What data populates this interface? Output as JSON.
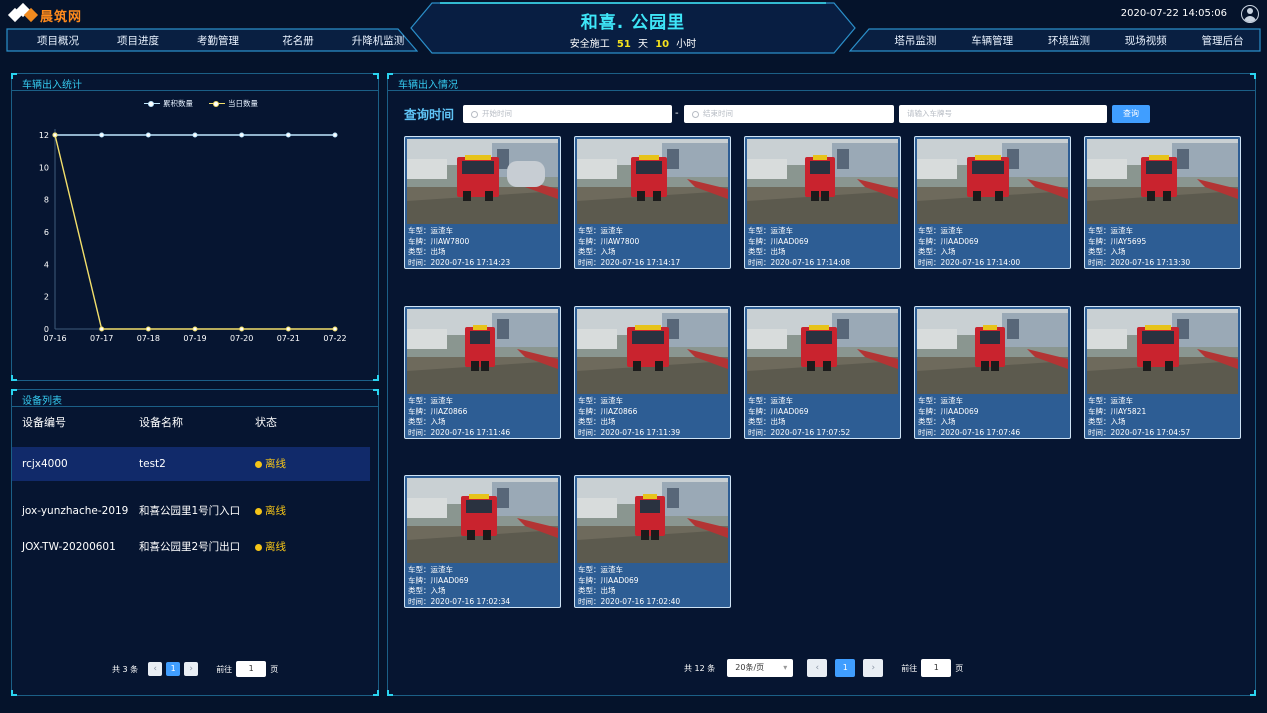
{
  "header": {
    "logo_text": "晨筑网",
    "site_name": "和喜. 公园里",
    "safety_prefix": "安全施工",
    "safety_days": "51",
    "safety_days_unit": "天",
    "safety_hours": "10",
    "safety_hours_unit": "小时",
    "datetime": "2020-07-22  14:05:06",
    "nav_left": [
      "项目概况",
      "项目进度",
      "考勤管理",
      "花名册",
      "升降机监测"
    ],
    "nav_right": [
      "塔吊监测",
      "车辆管理",
      "环境监测",
      "现场视频",
      "管理后台"
    ]
  },
  "stats_panel": {
    "title": "车辆出入统计"
  },
  "chart_data": {
    "type": "line",
    "x": [
      "07-16",
      "07-17",
      "07-18",
      "07-19",
      "07-20",
      "07-21",
      "07-22"
    ],
    "series": [
      {
        "name": "累积数量",
        "values": [
          12,
          12,
          12,
          12,
          12,
          12,
          12
        ],
        "color": "#bfe8ff"
      },
      {
        "name": "当日数量",
        "values": [
          12,
          0,
          0,
          0,
          0,
          0,
          0
        ],
        "color": "#f2df6b"
      }
    ],
    "yticks": [
      "0",
      "2",
      "4",
      "6",
      "8",
      "10",
      "12"
    ],
    "ylim": [
      0,
      12
    ],
    "legend_position": "top-center"
  },
  "device_panel": {
    "title": "设备列表",
    "columns": [
      "设备编号",
      "设备名称",
      "状态"
    ],
    "rows": [
      {
        "id": "rcjx4000",
        "name": "test2",
        "status": "离线"
      },
      {
        "id": "jox-yunzhache-2019",
        "name": "和喜公园里1号门入口",
        "status": "离线"
      },
      {
        "id": "JOX-TW-20200601",
        "name": "和喜公园里2号门出口",
        "status": "离线"
      }
    ],
    "pager": {
      "total_text": "共 3 条",
      "page": "1",
      "goto_label": "前往",
      "goto_value": "1",
      "goto_unit": "页"
    }
  },
  "vehicle_panel": {
    "title": "车辆出入情况",
    "query_label": "查询时间",
    "start_placeholder": "开始时间",
    "end_placeholder": "结束时间",
    "plate_placeholder": "请输入车牌号",
    "query_button": "查询",
    "separator": "-",
    "cards": [
      {
        "type": "车型：运渣车",
        "plate": "车牌：川AW7800",
        "dir": "类型：出场",
        "time": "时间：2020-07-16 17:14:23"
      },
      {
        "type": "车型：运渣车",
        "plate": "车牌：川AW7800",
        "dir": "类型：入场",
        "time": "时间：2020-07-16 17:14:17"
      },
      {
        "type": "车型：运渣车",
        "plate": "车牌：川AAD069",
        "dir": "类型：出场",
        "time": "时间：2020-07-16 17:14:08"
      },
      {
        "type": "车型：运渣车",
        "plate": "车牌：川AAD069",
        "dir": "类型：入场",
        "time": "时间：2020-07-16 17:14:00"
      },
      {
        "type": "车型：运渣车",
        "plate": "车牌：川AY5695",
        "dir": "类型：入场",
        "time": "时间：2020-07-16 17:13:30"
      },
      {
        "type": "车型：运渣车",
        "plate": "车牌：川AZ0866",
        "dir": "类型：入场",
        "time": "时间：2020-07-16 17:11:46"
      },
      {
        "type": "车型：运渣车",
        "plate": "车牌：川AZ0866",
        "dir": "类型：出场",
        "time": "时间：2020-07-16 17:11:39"
      },
      {
        "type": "车型：运渣车",
        "plate": "车牌：川AAD069",
        "dir": "类型：出场",
        "time": "时间：2020-07-16 17:07:52"
      },
      {
        "type": "车型：运渣车",
        "plate": "车牌：川AAD069",
        "dir": "类型：入场",
        "time": "时间：2020-07-16 17:07:46"
      },
      {
        "type": "车型：运渣车",
        "plate": "车牌：川AY5821",
        "dir": "类型：入场",
        "time": "时间：2020-07-16 17:04:57"
      },
      {
        "type": "车型：运渣车",
        "plate": "车牌：川AAD069",
        "dir": "类型：入场",
        "time": "时间：2020-07-16 17:02:34"
      },
      {
        "type": "车型：运渣车",
        "plate": "车牌：川AAD069",
        "dir": "类型：出场",
        "time": "时间：2020-07-16 17:02:40"
      }
    ],
    "pager": {
      "total_text": "共 12 条",
      "page_size": "20条/页",
      "page": "1",
      "goto_label": "前往",
      "goto_value": "1",
      "goto_unit": "页"
    }
  }
}
